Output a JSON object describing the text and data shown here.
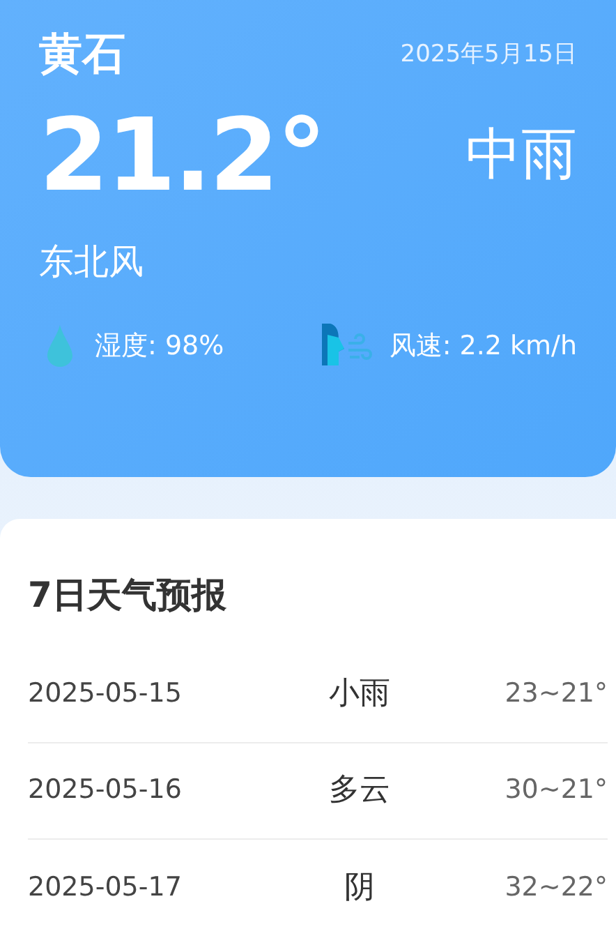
{
  "current": {
    "city": "黄石",
    "date": "2025年5月15日",
    "temperature": "21.2°",
    "condition": "中雨",
    "wind_direction": "东北风",
    "humidity": "湿度: 98%",
    "wind_speed": "风速: 2.2 km/h"
  },
  "forecast": {
    "title": "7日天气预报",
    "days": [
      {
        "date": "2025-05-15",
        "condition": "小雨",
        "range": "23~21°"
      },
      {
        "date": "2025-05-16",
        "condition": "多云",
        "range": "30~21°"
      },
      {
        "date": "2025-05-17",
        "condition": "阴",
        "range": "32~22°"
      }
    ]
  }
}
